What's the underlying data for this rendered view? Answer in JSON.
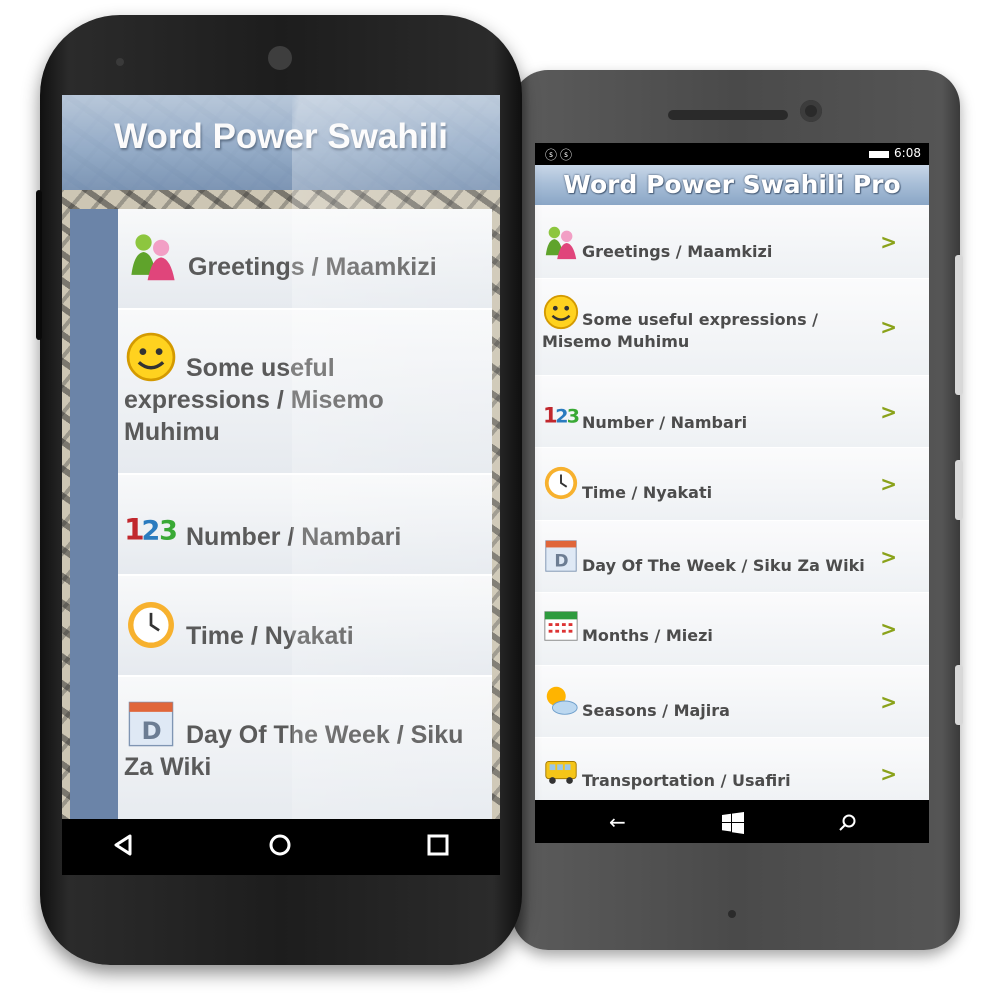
{
  "android": {
    "title": "Word Power Swahili",
    "items": [
      {
        "label": "Greetings / Maamkizi",
        "icon": "greetings-people-icon"
      },
      {
        "label": "Some useful expressions / Misemo Muhimu",
        "icon": "smiley-icon"
      },
      {
        "label": "Number / Nambari",
        "icon": "numbers-123-icon"
      },
      {
        "label": "Time / Nyakati",
        "icon": "clock-icon"
      },
      {
        "label": "Day Of The Week / Siku Za Wiki",
        "icon": "calendar-day-icon"
      }
    ],
    "nav": [
      "back-icon",
      "home-icon",
      "recents-icon"
    ]
  },
  "windows": {
    "status": {
      "time": "6:08"
    },
    "title": "Word Power Swahili Pro",
    "items": [
      {
        "label": "Greetings / Maamkizi",
        "icon": "greetings-people-icon"
      },
      {
        "label": "Some useful expressions / Misemo Muhimu",
        "icon": "smiley-icon"
      },
      {
        "label": "Number / Nambari",
        "icon": "numbers-123-icon"
      },
      {
        "label": "Time / Nyakati",
        "icon": "clock-icon"
      },
      {
        "label": "Day Of The Week / Siku Za Wiki",
        "icon": "calendar-day-icon"
      },
      {
        "label": "Months / Miezi",
        "icon": "calendar-month-icon"
      },
      {
        "label": "Seasons / Majira",
        "icon": "sun-cloud-icon"
      },
      {
        "label": "Transportation / Usafiri",
        "icon": "bus-icon"
      }
    ],
    "chevron": ">",
    "nav": [
      "back-arrow-icon",
      "windows-logo-icon",
      "search-icon"
    ]
  }
}
